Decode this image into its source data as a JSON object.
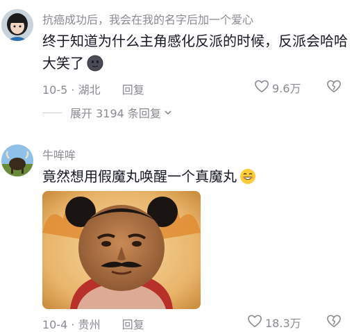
{
  "comments": [
    {
      "username": "抗癌成功后，我会在我的名字后加一个爱心",
      "text": "终于知道为什么主角感化反派的时候，反派会哈哈大笑了",
      "emoji": "dark-moon-face-emoji",
      "date": "10-5",
      "location": "湖北",
      "reply_label": "回复",
      "likes": "9.6万",
      "expand_label": "展开 3194 条回复"
    },
    {
      "username": "牛哞哞",
      "text": "竟然想用假魔丸唤醒一个真魔丸",
      "emoji": "smiling-emoji",
      "date": "10-4",
      "location": "贵州",
      "reply_label": "回复",
      "likes": "18.3万",
      "image": "meme-image"
    }
  ],
  "colors": {
    "text_primary": "#161823",
    "text_secondary": "#8a8b91",
    "background": "#ffffff"
  }
}
